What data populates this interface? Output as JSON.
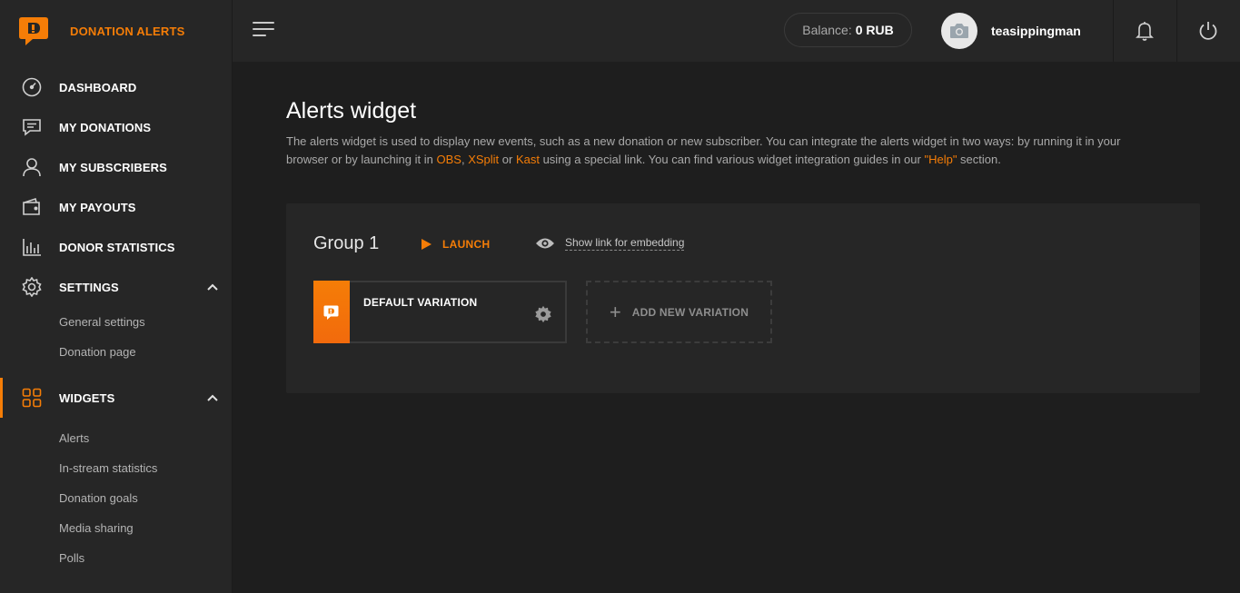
{
  "brand": {
    "name": "DONATION ALERTS",
    "accent": "#f57d07"
  },
  "nav": [
    {
      "label": "DASHBOARD",
      "icon": "dashboard-icon"
    },
    {
      "label": "MY DONATIONS",
      "icon": "chat-icon"
    },
    {
      "label": "MY SUBSCRIBERS",
      "icon": "user-icon"
    },
    {
      "label": "MY PAYOUTS",
      "icon": "wallet-icon"
    },
    {
      "label": "DONOR STATISTICS",
      "icon": "bar-chart-icon"
    },
    {
      "label": "SETTINGS",
      "icon": "gear-icon",
      "expanded": true,
      "children": [
        "General settings",
        "Donation page"
      ]
    },
    {
      "label": "WIDGETS",
      "icon": "grid-icon",
      "expanded": true,
      "active": true,
      "children": [
        "Alerts",
        "In-stream statistics",
        "Donation goals",
        "Media sharing",
        "Polls"
      ]
    }
  ],
  "topbar": {
    "balance_label": "Balance:",
    "balance_value": "0 RUB",
    "username": "teasippingman"
  },
  "main": {
    "title": "Alerts widget",
    "description": {
      "part1": "The alerts widget is used to display new events, such as a new donation or new subscriber. You can integrate the alerts widget in two ways: by running it in your browser or by launching it in ",
      "link_obs": "OBS",
      "sep1": ", ",
      "link_xsplit": "XSplit",
      "sep2": " or ",
      "link_kast": "Kast",
      "part2": " using a special link. You can find various widget integration guides in our ",
      "link_help": "\"Help\"",
      "part3": " section."
    },
    "group": {
      "title": "Group 1",
      "launch_label": "LAUNCH",
      "embed_label": "Show link for embedding",
      "variations": [
        {
          "name": "DEFAULT VARIATION"
        }
      ],
      "add_variation_label": "ADD NEW VARIATION"
    }
  }
}
